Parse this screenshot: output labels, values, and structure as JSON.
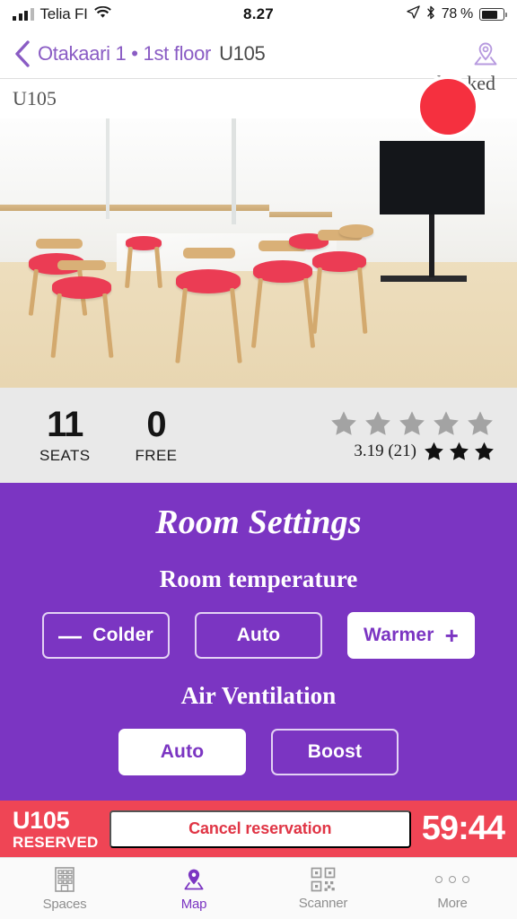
{
  "status_bar": {
    "carrier": "Telia FI",
    "time": "8.27",
    "battery_percent": "78 %",
    "signal_icon": "signal-bars-icon",
    "wifi_icon": "wifi-icon",
    "location_icon": "location-arrow-icon",
    "bluetooth_icon": "bluetooth-icon",
    "battery_icon": "battery-icon"
  },
  "navbar": {
    "back_icon": "back-chevron-icon",
    "breadcrumb": "Otakaari 1 • 1st floor",
    "room": "U105",
    "map_pin_icon": "map-pin-icon"
  },
  "photo": {
    "room_label": "U105",
    "status_tag": "booked",
    "status_dot_color": "#f5303f",
    "alt": "meeting room with white table, red chairs and wall mounted tv"
  },
  "stats": {
    "seats_value": "11",
    "seats_label": "SEATS",
    "free_value": "0",
    "free_label": "FREE",
    "rating_value": "3.19 (21)",
    "rating_stars_empty": 5,
    "rating_stars_filled": 3,
    "star_icon": "star-icon"
  },
  "settings": {
    "title": "Room Settings",
    "temperature": {
      "heading": "Room temperature",
      "colder_label": "Colder",
      "colder_sign": "—",
      "auto_label": "Auto",
      "warmer_label": "Warmer",
      "warmer_sign": "+",
      "active": "Warmer"
    },
    "ventilation": {
      "heading": "Air Ventilation",
      "auto_label": "Auto",
      "boost_label": "Boost",
      "active": "Auto"
    },
    "accent_color": "#7b35c2"
  },
  "reservation": {
    "room": "U105",
    "state": "RESERVED",
    "cancel_label": "Cancel reservation",
    "timer": "59:44",
    "bar_color": "#ef4555"
  },
  "tabbar": {
    "items": [
      {
        "label": "Spaces",
        "icon": "building-icon",
        "active": false
      },
      {
        "label": "Map",
        "icon": "map-pin-icon",
        "active": true
      },
      {
        "label": "Scanner",
        "icon": "qr-code-icon",
        "active": false
      },
      {
        "label": "More",
        "icon": "ellipsis-icon",
        "active": false
      }
    ]
  }
}
